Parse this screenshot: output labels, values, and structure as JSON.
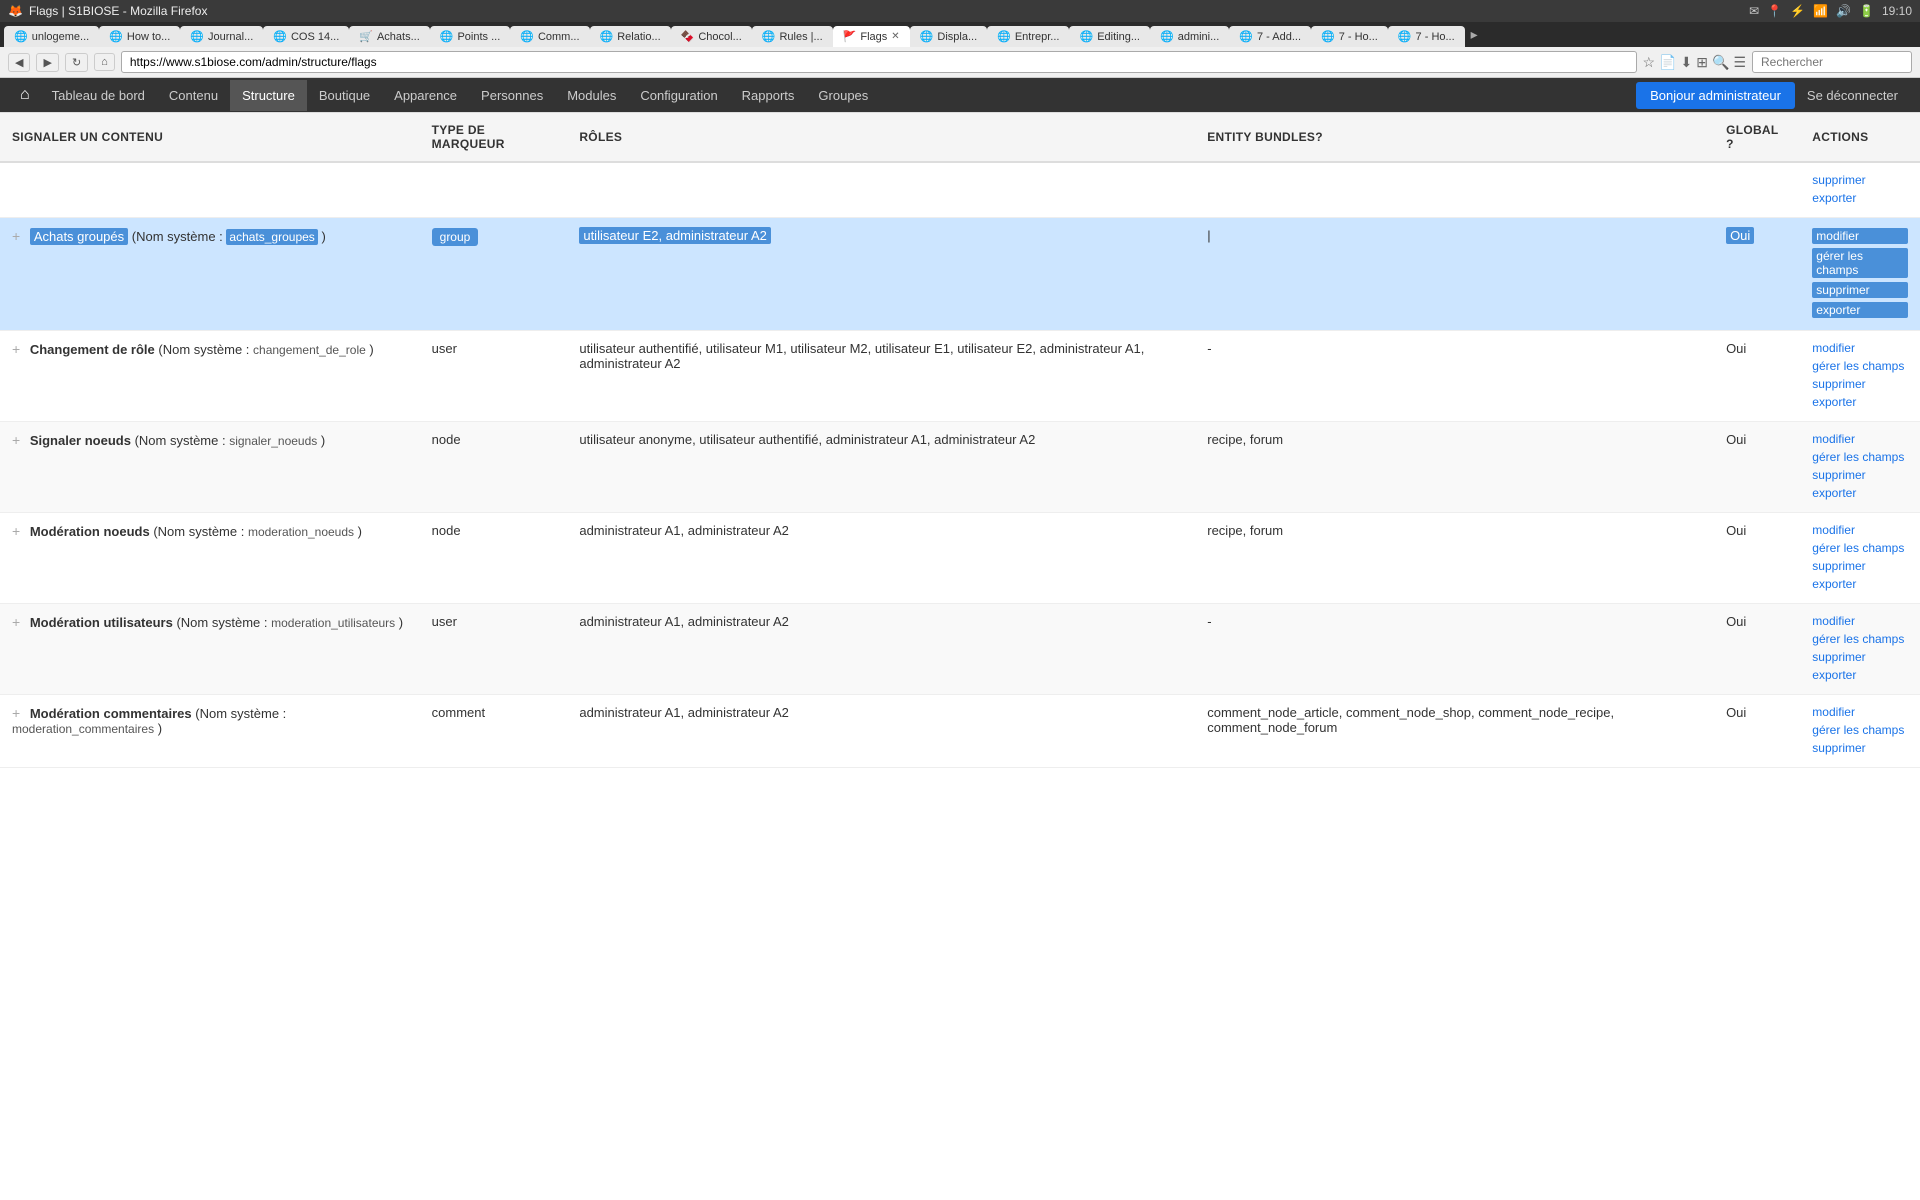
{
  "browser": {
    "title": "Flags | S1BIOSE - Mozilla Firefox",
    "app_name": "Firefox",
    "url": "https://www.s1biose.com/admin/structure/flags",
    "search_placeholder": "Rechercher",
    "time": "19:10"
  },
  "tabs": [
    {
      "label": "unlogeme...",
      "active": false
    },
    {
      "label": "How to...",
      "active": false
    },
    {
      "label": "Journal...",
      "active": false
    },
    {
      "label": "COS 14...",
      "active": false
    },
    {
      "label": "Achats...",
      "active": false
    },
    {
      "label": "Points ...",
      "active": false
    },
    {
      "label": "Comm...",
      "active": false
    },
    {
      "label": "Relatio...",
      "active": false
    },
    {
      "label": "Chocol...",
      "active": false
    },
    {
      "label": "Rules |...",
      "active": false
    },
    {
      "label": "Flags",
      "active": true
    },
    {
      "label": "Displa...",
      "active": false
    },
    {
      "label": "Entrepr...",
      "active": false
    },
    {
      "label": "Editing...",
      "active": false
    },
    {
      "label": "admini...",
      "active": false
    },
    {
      "label": "7 - Add...",
      "active": false
    },
    {
      "label": "7 - Ho...",
      "active": false
    },
    {
      "label": "7 - Ho...",
      "active": false
    }
  ],
  "nav": {
    "home_icon": "⌂",
    "items": [
      {
        "label": "Tableau de bord",
        "active": false
      },
      {
        "label": "Contenu",
        "active": false
      },
      {
        "label": "Structure",
        "active": true
      },
      {
        "label": "Boutique",
        "active": false
      },
      {
        "label": "Apparence",
        "active": false
      },
      {
        "label": "Personnes",
        "active": false
      },
      {
        "label": "Modules",
        "active": false
      },
      {
        "label": "Configuration",
        "active": false
      },
      {
        "label": "Rapports",
        "active": false
      },
      {
        "label": "Groupes",
        "active": false
      }
    ],
    "user_label": "Bonjour administrateur",
    "logout_label": "Se déconnecter"
  },
  "table": {
    "columns": [
      "SIGNALER UN CONTENU",
      "TYPE DE MARQUEUR",
      "RÔLES",
      "ENTITY BUNDLES?",
      "GLOBAL ?",
      "ACTIONS"
    ],
    "rows": [
      {
        "id": "empty-row",
        "name": "",
        "system_name": "",
        "type": "",
        "roles": "",
        "bundles": "",
        "global": "",
        "actions": [
          "supprimer",
          "exporter"
        ],
        "highlighted": false,
        "empty": true
      },
      {
        "id": "achats-groupes",
        "name": "Achats groupés",
        "system_name_prefix": "Nom système :",
        "system_name": "achats_groupes",
        "type": "group",
        "roles": "utilisateur E2, administrateur A2",
        "bundles": "|",
        "global": "Oui",
        "actions": [
          "modifier",
          "gérer les champs",
          "supprimer",
          "exporter"
        ],
        "highlighted": true
      },
      {
        "id": "changement-role",
        "name": "Changement de rôle",
        "system_name_prefix": "Nom système :",
        "system_name": "changement_de_role",
        "type": "user",
        "roles": "utilisateur authentifié, utilisateur M1, utilisateur M2, utilisateur E1, utilisateur E2, administrateur A1, administrateur A2",
        "bundles": "-",
        "global": "Oui",
        "actions": [
          "modifier",
          "gérer les champs",
          "supprimer",
          "exporter"
        ],
        "highlighted": false
      },
      {
        "id": "signaler-noeuds",
        "name": "Signaler noeuds",
        "system_name_prefix": "Nom système :",
        "system_name": "signaler_noeuds",
        "type": "node",
        "roles": "utilisateur anonyme, utilisateur authentifié, administrateur A1, administrateur A2",
        "bundles": "recipe, forum",
        "global": "Oui",
        "actions": [
          "modifier",
          "gérer les champs",
          "supprimer",
          "exporter"
        ],
        "highlighted": false
      },
      {
        "id": "moderation-noeuds",
        "name": "Modération noeuds",
        "system_name_prefix": "Nom système :",
        "system_name": "moderation_noeuds",
        "type": "node",
        "roles": "administrateur A1, administrateur A2",
        "bundles": "recipe, forum",
        "global": "Oui",
        "actions": [
          "modifier",
          "gérer les champs",
          "supprimer",
          "exporter"
        ],
        "highlighted": false
      },
      {
        "id": "moderation-utilisateurs",
        "name": "Modération utilisateurs",
        "system_name_prefix": "Nom système :",
        "system_name": "moderation_utilisateurs",
        "type": "user",
        "roles": "administrateur A1, administrateur A2",
        "bundles": "-",
        "global": "Oui",
        "actions": [
          "modifier",
          "gérer les champs",
          "supprimer",
          "exporter"
        ],
        "highlighted": false
      },
      {
        "id": "moderation-commentaires",
        "name": "Modération commentaires",
        "system_name_prefix": "Nom système :",
        "system_name": "moderation_commentaires",
        "type": "comment",
        "roles": "administrateur A1, administrateur A2",
        "bundles": "comment_node_article, comment_node_shop, comment_node_recipe, comment_node_forum",
        "global": "Oui",
        "actions": [
          "modifier",
          "gérer les champs",
          "supprimer"
        ],
        "highlighted": false
      }
    ]
  }
}
